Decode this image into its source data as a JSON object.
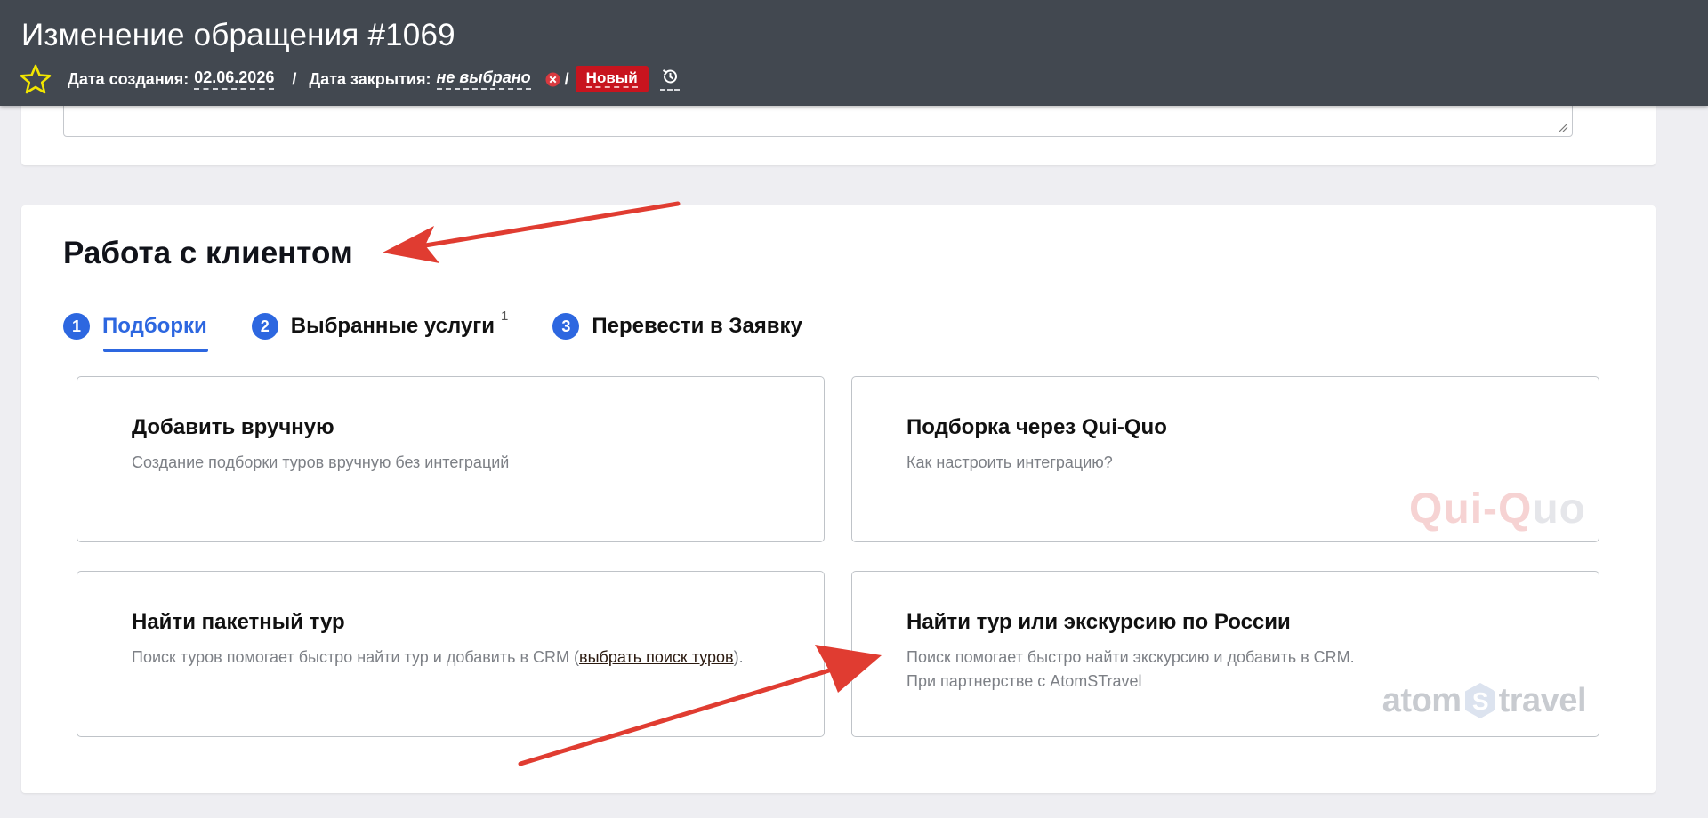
{
  "header": {
    "title": "Изменение обращения #1069",
    "created_label": "Дата создания:",
    "created_value": "02.06.2026",
    "separator": "/",
    "closed_label": "Дата закрытия:",
    "closed_value": "не выбрано",
    "status_separator": "/",
    "status": "Новый"
  },
  "section": {
    "title": "Работа с клиентом",
    "tabs": [
      {
        "num": "1",
        "label": "Подборки",
        "active": true,
        "sup": ""
      },
      {
        "num": "2",
        "label": "Выбранные услуги",
        "active": false,
        "sup": "1"
      },
      {
        "num": "3",
        "label": "Перевести в Заявку",
        "active": false,
        "sup": ""
      }
    ],
    "options": [
      {
        "title": "Добавить вручную",
        "desc": "Создание подборки туров вручную без интеграций"
      },
      {
        "title": "Подборка через Qui-Quo",
        "link": "Как настроить интеграцию?",
        "logo_a": "Qui-Q",
        "logo_b": "uo"
      },
      {
        "title": "Найти пакетный тур",
        "desc_before": "Поиск туров помогает быстро найти тур и добавить в CRM (",
        "desc_link": "выбрать поиск туров",
        "desc_after": ")."
      },
      {
        "title": "Найти тур или экскурсию по России",
        "desc_line1": "Поиск помогает быстро найти экскурсию и добавить в CRM.",
        "desc_line2": "При партнерстве с AtomSTravel",
        "logo_a": "atom",
        "logo_hex": "S",
        "logo_b": "travel"
      }
    ]
  },
  "colors": {
    "header_bg": "#424850",
    "accent": "#2d67e0",
    "status_badge": "#c8141e",
    "annotation_arrow": "#e03c31"
  }
}
